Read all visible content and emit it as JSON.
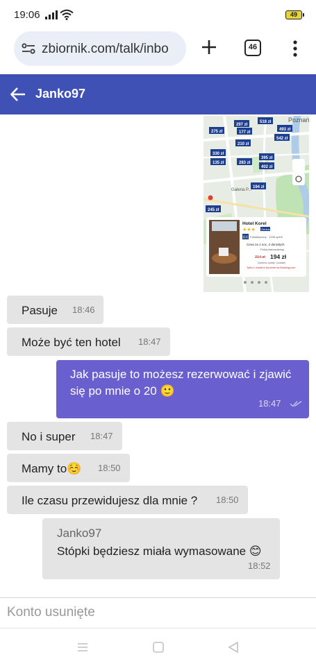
{
  "status_bar": {
    "time": "19:06",
    "battery": "49"
  },
  "browser": {
    "url": "zbiornik.com/talk/inbo",
    "tab_count": "46"
  },
  "header": {
    "title": "Janko97"
  },
  "messages": [
    {
      "text": "Pasuje",
      "time": "18:46"
    },
    {
      "text": "Może być ten hotel",
      "time": "18:47"
    },
    {
      "text": "Jak pasuje to możesz rezerwować i zjawić się po mnie o 20 🙂",
      "time": "18:47"
    },
    {
      "text": "No i super",
      "time": "18:47"
    },
    {
      "text": "Mamy to☺️",
      "time": "18:50"
    },
    {
      "text": "Ile czasu przewidujesz dla mnie ?",
      "time": "18:50"
    },
    {
      "author": "Janko97",
      "text": "Stópki będziesz miała wymasowane 😊",
      "time": "18:52"
    }
  ],
  "input": {
    "placeholder": "Konto usunięte"
  },
  "map": {
    "city_label": "Poznań",
    "gallery_label": "Galeria P...",
    "prices": [
      "297 zł",
      "518 zł",
      "275 zł",
      "177 zł",
      "493 zł",
      "210 zł",
      "542 zł",
      "330 zł",
      "135 zł",
      "283 zł",
      "395 zł",
      "402 zł",
      "194 zł",
      "245 zł"
    ],
    "hotel": {
      "name": "Hotel Korel",
      "stars": 3,
      "badge": "Genius",
      "rating": "8.6",
      "rating_label": "Fantastyczny · 1206 opinii",
      "stay": "Cena za 1 noc, 2 dorosłych",
      "room": "Pokój dwuosobowy",
      "old_price": "214 zł",
      "price": "194 zł",
      "taxes": "Zawiera opłaty i podatki",
      "availability": "Tylko 1 został w tej cenie na Booking.com"
    }
  }
}
